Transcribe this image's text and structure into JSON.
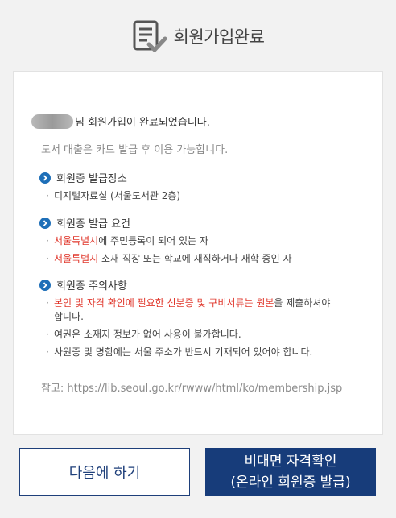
{
  "header": {
    "title": "회원가입완료",
    "icon": "document-check-icon"
  },
  "card": {
    "message_suffix": "님 회원가입이 완료되었습니다.",
    "subtext": "도서 대출은 카드 발급 후 이용 가능합니다.",
    "sections": [
      {
        "title": "회원증 발급장소",
        "items": [
          {
            "text": "디지털자료실 (서울도서관 2층)"
          }
        ]
      },
      {
        "title": "회원증 발급 요건",
        "items": [
          {
            "highlight": "서울특별시",
            "text": "에 주민등록이 되어 있는 자"
          },
          {
            "highlight": "서울특별시",
            "text": " 소재 직장 또는 학교에 재직하거나 재학 중인 자"
          }
        ]
      },
      {
        "title": "회원증 주의사항",
        "items": [
          {
            "highlight": "본인 및 자격 확인에 필요한 신분증 및 구비서류는 원본",
            "text": "을 제출하셔야 합니다."
          },
          {
            "text": "여권은 소재지 정보가 없어 사용이 불가합니다."
          },
          {
            "text": "사원증 및 명함에는 서울 주소가 반드시 기재되어 있어야 합니다."
          }
        ]
      }
    ],
    "reference": "참고: https://lib.seoul.go.kr/rwww/html/ko/membership.jsp"
  },
  "buttons": {
    "later": "다음에 하기",
    "verify_line1": "비대면 자격확인",
    "verify_line2": "(온라인 회원증 발급)"
  },
  "colors": {
    "accent": "#173c7a",
    "highlight": "#e0372c",
    "section_icon": "#1e6fb8"
  }
}
